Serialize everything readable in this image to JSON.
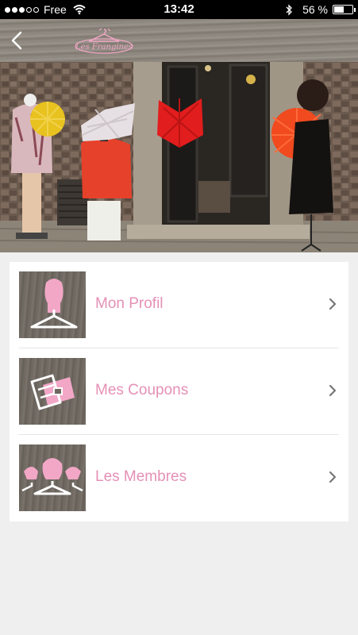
{
  "status_bar": {
    "carrier": "Free",
    "time": "13:42",
    "battery": "56 %",
    "battery_level": 0.56,
    "signal_bars_filled": 3,
    "signal_bars_total": 5
  },
  "header": {
    "logo_text": "Les Frangines"
  },
  "menu": {
    "items": [
      {
        "label": "Mon Profil",
        "icon": "profile-icon"
      },
      {
        "label": "Mes Coupons",
        "icon": "coupon-icon"
      },
      {
        "label": "Les Membres",
        "icon": "members-icon"
      }
    ]
  },
  "colors": {
    "accent_pink": "#e590b6",
    "status_bar_bg": "#000000",
    "page_bg": "#efefef"
  }
}
